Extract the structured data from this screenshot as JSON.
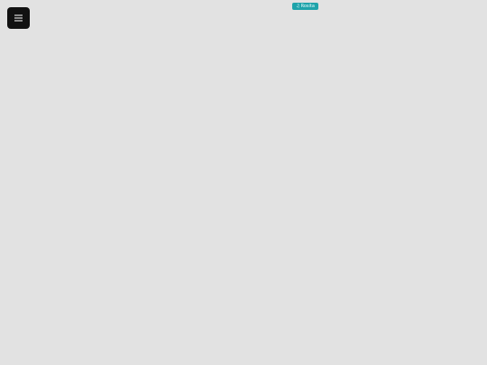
{
  "page": {
    "background_color": "#e2e2e2"
  },
  "menu_button": {
    "icon": "hamburger-menu-icon",
    "color": "#111111"
  },
  "badge": {
    "icon": "music-note-icon",
    "label": "Rosita",
    "color": "#1fa3aa"
  }
}
